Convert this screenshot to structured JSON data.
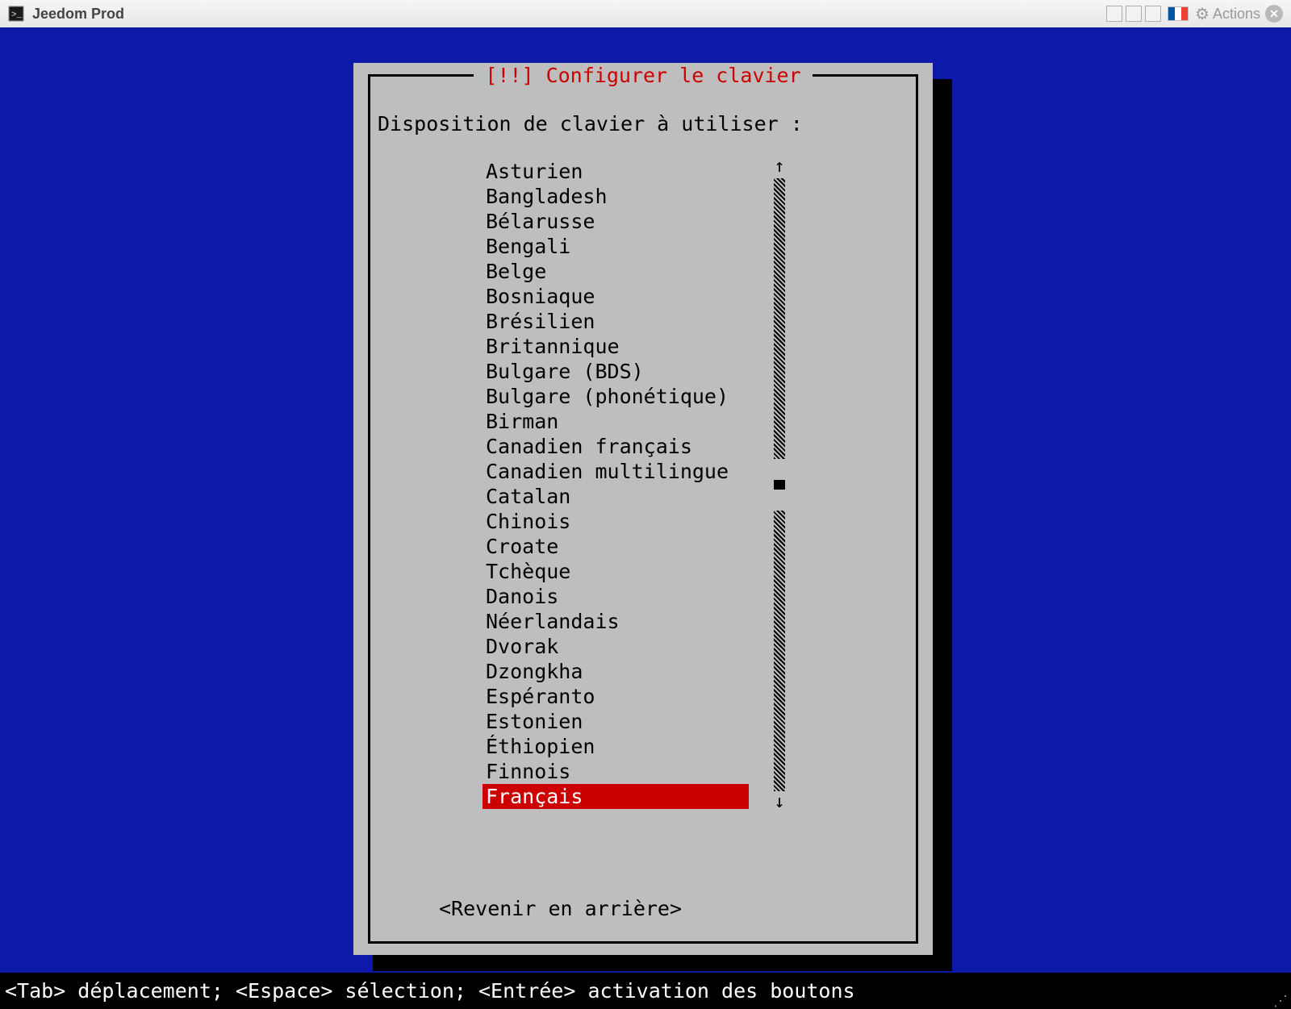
{
  "titlebar": {
    "title": "Jeedom Prod",
    "actions_label": "Actions",
    "flag": "france"
  },
  "dialog": {
    "title": "[!!] Configurer le clavier",
    "prompt": "Disposition de clavier à utiliser :",
    "options": [
      "Asturien",
      "Bangladesh",
      "Bélarusse",
      "Bengali",
      "Belge",
      "Bosniaque",
      "Brésilien",
      "Britannique",
      "Bulgare (BDS)",
      "Bulgare (phonétique)",
      "Birman",
      "Canadien français",
      "Canadien multilingue",
      "Catalan",
      "Chinois",
      "Croate",
      "Tchèque",
      "Danois",
      "Néerlandais",
      "Dvorak",
      "Dzongkha",
      "Espéranto",
      "Estonien",
      "Éthiopien",
      "Finnois",
      "Français"
    ],
    "selected_index": 25,
    "go_back": "<Revenir en arrière>"
  },
  "bottom_bar": {
    "help": "<Tab> déplacement; <Espace> sélection; <Entrée> activation des boutons"
  },
  "colors": {
    "installer_blue": "#0d1aa9",
    "dialog_grey": "#bebebe",
    "alert_red": "#cc0000"
  }
}
